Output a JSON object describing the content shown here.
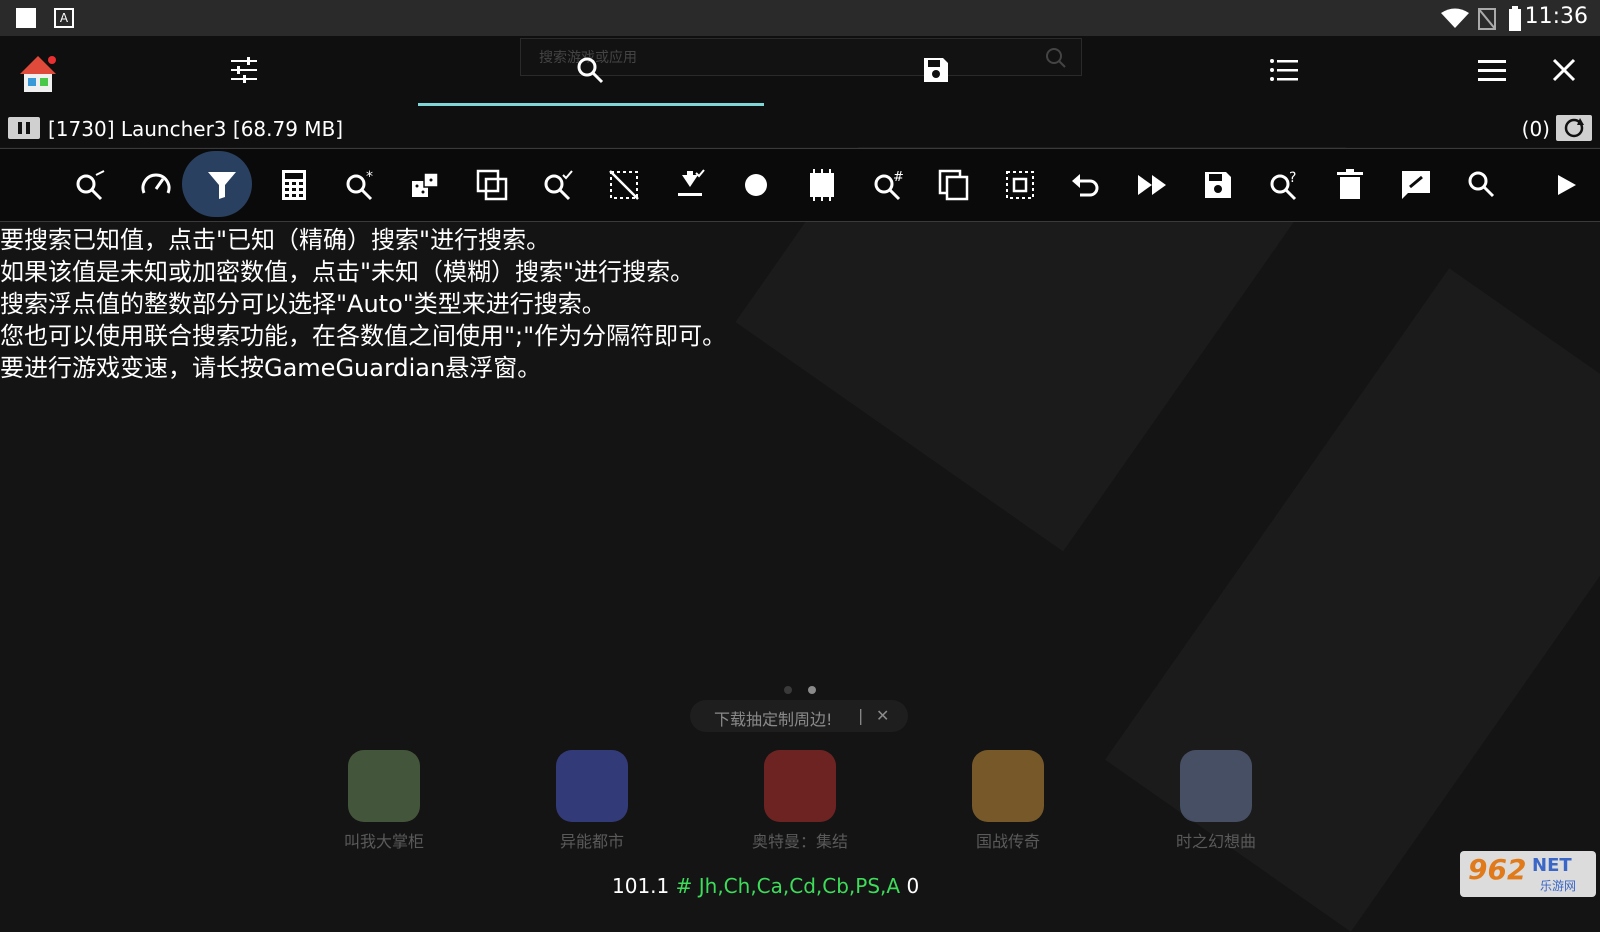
{
  "status_bar": {
    "time": "11:36"
  },
  "toolbar": {
    "search_placeholder": "搜索游戏或应用",
    "icons": [
      "home-app-icon",
      "sliders-icon",
      "search-icon",
      "save-icon",
      "list-icon",
      "menu-icon",
      "close-icon"
    ]
  },
  "process": {
    "label": "[1730] Launcher3 [68.79 MB]",
    "count": "(0)"
  },
  "tools": [
    "search-near-icon",
    "speed-icon",
    "filter-icon",
    "calculator-icon",
    "search-fuzzy-icon",
    "random-icon",
    "copy-select-icon",
    "search-check-icon",
    "deselect-icon",
    "download-check-icon",
    "record-icon",
    "memory-icon",
    "search-number-icon",
    "copy-icon",
    "select-all-icon",
    "undo-icon",
    "fast-forward-icon",
    "save-icon",
    "search-help-icon",
    "delete-icon",
    "edit-icon",
    "search-icon",
    "play-icon"
  ],
  "message": [
    "要搜索已知值，点击\"已知（精确）搜索\"进行搜索。",
    "如果该值是未知或加密数值，点击\"未知（模糊）搜索\"进行搜索。",
    "搜索浮点值的整数部分可以选择\"Auto\"类型来进行搜索。",
    "您也可以使用联合搜索功能，在各数值之间使用\";\"作为分隔符即可。",
    "要进行游戏变速，请长按GameGuardian悬浮窗。"
  ],
  "launcher": {
    "promo_text": "下载抽定制周边!",
    "promo_divider": "|",
    "promo_close": "✕",
    "apps": [
      {
        "name": "叫我大掌柜",
        "color": "#6a8a5a"
      },
      {
        "name": "异能都市",
        "color": "#4a5ac8"
      },
      {
        "name": "奥特曼：集结",
        "color": "#b83030"
      },
      {
        "name": "国战传奇",
        "color": "#c8903a"
      },
      {
        "name": "时之幻想曲",
        "color": "#6a7aa0"
      }
    ]
  },
  "bottom": {
    "value": "101.1",
    "hash": "#",
    "types": "Jh,Ch,Ca,Cd,Cb,PS,A",
    "zero": "0"
  },
  "watermark": {
    "number": "962",
    "net": "NET",
    "sub": "乐游网"
  }
}
